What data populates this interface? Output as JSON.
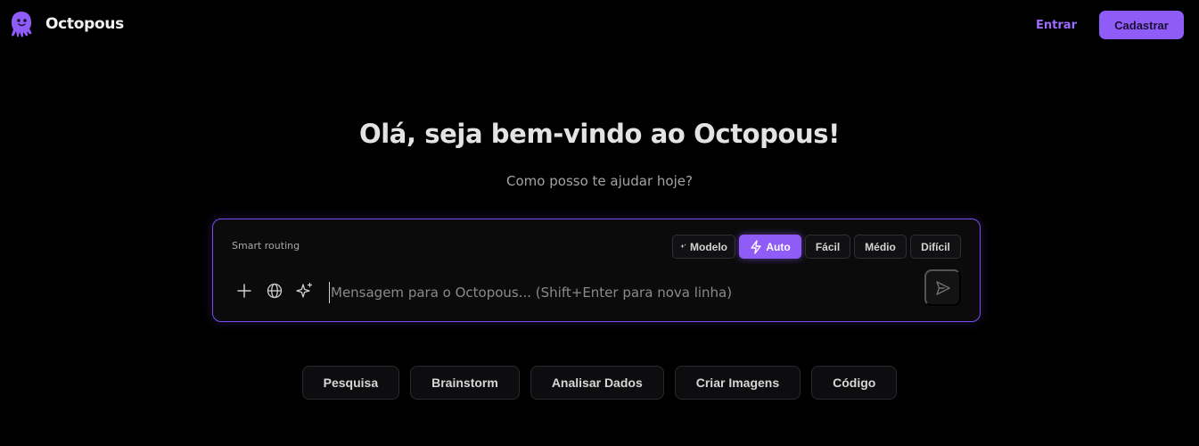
{
  "brand": {
    "name": "Octopous",
    "logo_icon": "octopus-logo-icon",
    "accent": "#8f5cf7"
  },
  "nav": {
    "login_label": "Entrar",
    "signup_label": "Cadastrar"
  },
  "hero": {
    "title": "Olá, seja bem-vindo ao Octopous!",
    "subtitle": "Como posso te ajudar hoje?"
  },
  "composer": {
    "smart_routing_label": "Smart routing",
    "modes": [
      {
        "label": "Modelo",
        "icon": "sparkles-icon",
        "active": false
      },
      {
        "label": "Auto",
        "icon": "lightning-icon",
        "active": true
      },
      {
        "label": "Fácil",
        "active": false
      },
      {
        "label": "Médio",
        "active": false
      },
      {
        "label": "Difícil",
        "active": false
      }
    ],
    "tools": [
      "plus-icon",
      "globe-icon",
      "sparkle-icon"
    ],
    "input_value": "",
    "input_placeholder": "Mensagem para o Octopous... (Shift+Enter para nova linha)",
    "send_icon": "send-icon"
  },
  "suggestions": [
    "Pesquisa",
    "Brainstorm",
    "Analisar Dados",
    "Criar Imagens",
    "Código"
  ]
}
